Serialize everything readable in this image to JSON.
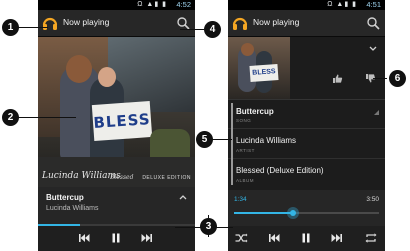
{
  "phone_left": {
    "status": {
      "time": "4:52",
      "icons": "Ω ▲▮ ▮"
    },
    "actionbar": {
      "title": "Now playing"
    },
    "album_art": {
      "signature": "Lucinda Williams",
      "subtitle": "Blessed",
      "edition": "DELUXE EDITION",
      "sign_text": "BLESS"
    },
    "song": {
      "title": "Buttercup",
      "artist": "Lucinda Williams"
    },
    "progress_fraction": 0.27
  },
  "phone_right": {
    "status": {
      "time": "4:51",
      "icons": "Ω ▲▮ ▮"
    },
    "actionbar": {
      "title": "Now playing"
    },
    "thumb_sign": "BLESS",
    "metadata": [
      {
        "value": "Buttercup",
        "label": "SONG"
      },
      {
        "value": "Lucinda Williams",
        "label": "ARTIST"
      },
      {
        "value": "Blessed (Deluxe Edition)",
        "label": "ALBUM"
      }
    ],
    "seek": {
      "elapsed": "1:34",
      "total": "3:50",
      "fraction": 0.41
    }
  },
  "callouts": {
    "c1": "1",
    "c2": "2",
    "c3": "3",
    "c4": "4",
    "c5": "5",
    "c6": "6"
  },
  "colors": {
    "accent": "#33b5e5",
    "actionbar": "#272727",
    "background": "#1c1c1c"
  }
}
